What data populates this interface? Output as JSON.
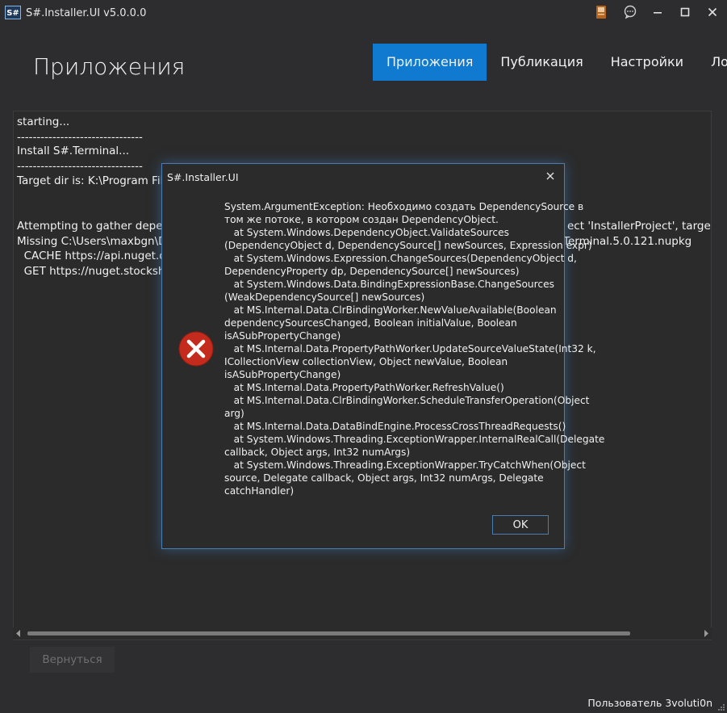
{
  "window": {
    "icon_text": "S#",
    "title": "S#.Installer.UI v5.0.0.0"
  },
  "header": {
    "page_title": "Приложения",
    "tabs": [
      {
        "label": "Приложения",
        "active": true
      },
      {
        "label": "Публикация",
        "active": false
      },
      {
        "label": "Настройки",
        "active": false
      },
      {
        "label": "Логи",
        "active": false
      }
    ]
  },
  "log": {
    "lines": [
      "starting...",
      "--------------------------------",
      "Install S#.Terminal...",
      "--------------------------------",
      "Target dir is: K:\\Program Files",
      "",
      "Attempting to gather depend",
      "Missing C:\\Users\\maxbgn\\Do",
      "  CACHE https://api.nuget.org",
      "  GET https://nuget.stockshar"
    ],
    "right_fragments": [
      "ect 'InstallerProject', targeting '",
      "Terminal.5.0.121.nupkg"
    ]
  },
  "footer": {
    "back_label": "Вернуться",
    "user_status": "Пользователь 3voluti0n"
  },
  "dialog": {
    "title": "S#.Installer.UI",
    "message": "System.ArgumentException: Необходимо создать DependencySource в\nтом же потоке, в котором создан DependencyObject.\n   at System.Windows.DependencyObject.ValidateSources\n(DependencyObject d, DependencySource[] newSources, Expression expr)\n   at System.Windows.Expression.ChangeSources(DependencyObject d,\nDependencyProperty dp, DependencySource[] newSources)\n   at System.Windows.Data.BindingExpressionBase.ChangeSources\n(WeakDependencySource[] newSources)\n   at MS.Internal.Data.ClrBindingWorker.NewValueAvailable(Boolean\ndependencySourcesChanged, Boolean initialValue, Boolean\nisASubPropertyChange)\n   at MS.Internal.Data.PropertyPathWorker.UpdateSourceValueState(Int32 k,\nICollectionView collectionView, Object newValue, Boolean\nisASubPropertyChange)\n   at MS.Internal.Data.PropertyPathWorker.RefreshValue()\n   at MS.Internal.Data.ClrBindingWorker.ScheduleTransferOperation(Object\narg)\n   at MS.Internal.Data.DataBindEngine.ProcessCrossThreadRequests()\n   at System.Windows.Threading.ExceptionWrapper.InternalRealCall(Delegate\ncallback, Object args, Int32 numArgs)\n   at System.Windows.Threading.ExceptionWrapper.TryCatchWhen(Object\nsource, Delegate callback, Object args, Int32 numArgs, Delegate\ncatchHandler)",
    "ok_label": "OK"
  },
  "colors": {
    "background": "#2d2d30",
    "accent": "#0f7ad0",
    "dialog_border": "#4d7db0",
    "error_icon": "#c42b1c"
  },
  "icons": {
    "titlebar": [
      "app-logo-icon",
      "book-icon",
      "chat-icon",
      "minimize-icon",
      "maximize-icon",
      "close-icon"
    ],
    "dialog": [
      "close-icon",
      "error-icon"
    ]
  }
}
